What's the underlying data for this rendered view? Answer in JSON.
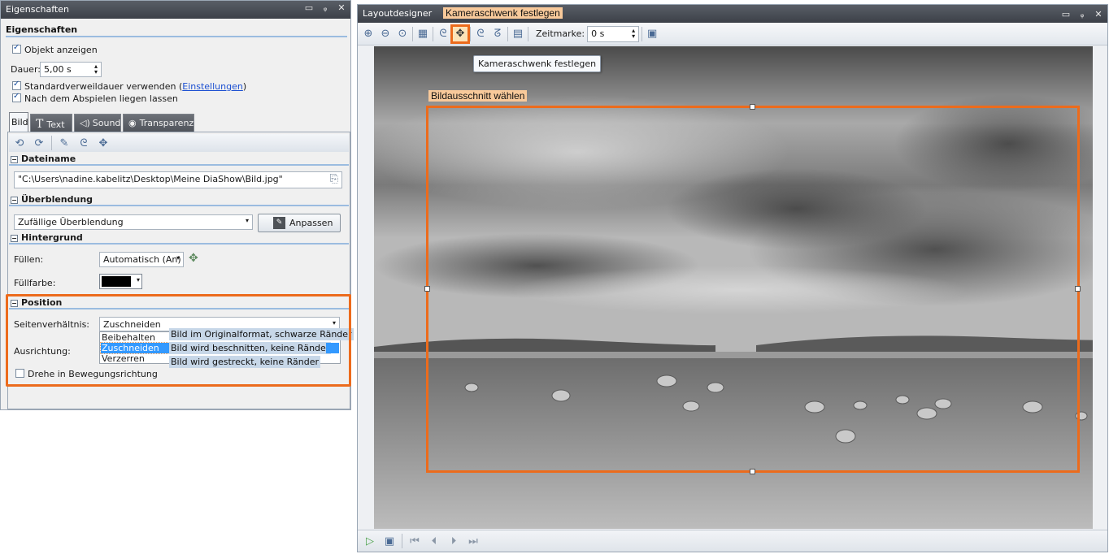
{
  "properties_panel": {
    "title": "Eigenschaften",
    "window_buttons": [
      "▭",
      "📌",
      "✕"
    ],
    "header": "Eigenschaften",
    "show_object_label": "Objekt anzeigen",
    "show_object_checked": true,
    "duration_label": "Dauer:",
    "duration_value": "5,00 s",
    "standard_duration_label_prefix": "Standardverweildauer verwenden (",
    "standard_duration_link": "Einstellungen",
    "standard_duration_label_suffix": ")",
    "standard_duration_checked": true,
    "keep_after_play_label": "Nach dem Abspielen liegen lassen",
    "keep_after_play_checked": true,
    "tabs": [
      {
        "label": "Bild",
        "icon": "",
        "active": true
      },
      {
        "label": "Text",
        "icon": "T",
        "active": false
      },
      {
        "label": "Sound",
        "icon": "🔈",
        "active": false
      },
      {
        "label": "Transparenz",
        "icon": "👁",
        "active": false
      }
    ],
    "filename_section": "Dateiname",
    "filename_value": "\"C:\\Users\\nadine.kabelitz\\Desktop\\Meine DiaShow\\Bild.jpg\"",
    "transition_section": "Überblendung",
    "transition_value": "Zufällige Überblendung",
    "adjust_button": "Anpassen",
    "background_section": "Hintergrund",
    "fill_label": "Füllen:",
    "fill_value": "Automatisch (An)",
    "fill_color_label": "Füllfarbe:",
    "fill_color": "#000000",
    "position_section": "Position",
    "aspect_label": "Seitenverhältnis:",
    "aspect_value": "Zuschneiden",
    "aspect_options": [
      "Beibehalten",
      "Zuschneiden",
      "Verzerren"
    ],
    "aspect_selected_index": 1,
    "aspect_hints": [
      "Bild im Originalformat, schwarze Ränder",
      "Bild wird beschnitten, keine Ränder",
      "Bild wird gestreckt, keine Ränder"
    ],
    "alignment_label": "Ausrichtung:",
    "rotate_label": "Drehe in Bewegungsrichtung",
    "rotate_checked": false
  },
  "layout_designer": {
    "title": "Layoutdesigner",
    "window_buttons": [
      "▭",
      "📌",
      "✕"
    ],
    "toolbar": {
      "time_marker_label": "Zeitmarke:",
      "time_marker_value": "0 s"
    },
    "tooltip": "Kameraschwenk festlegen"
  },
  "annotations": {
    "camera_pan_callout": "Kameraschwenk festlegen",
    "crop_callout": "Bildausschnitt wählen"
  },
  "colors": {
    "highlight_orange": "#ec6b1c",
    "selection_blue": "#3399ff",
    "section_rule_blue": "#9bbce0"
  }
}
